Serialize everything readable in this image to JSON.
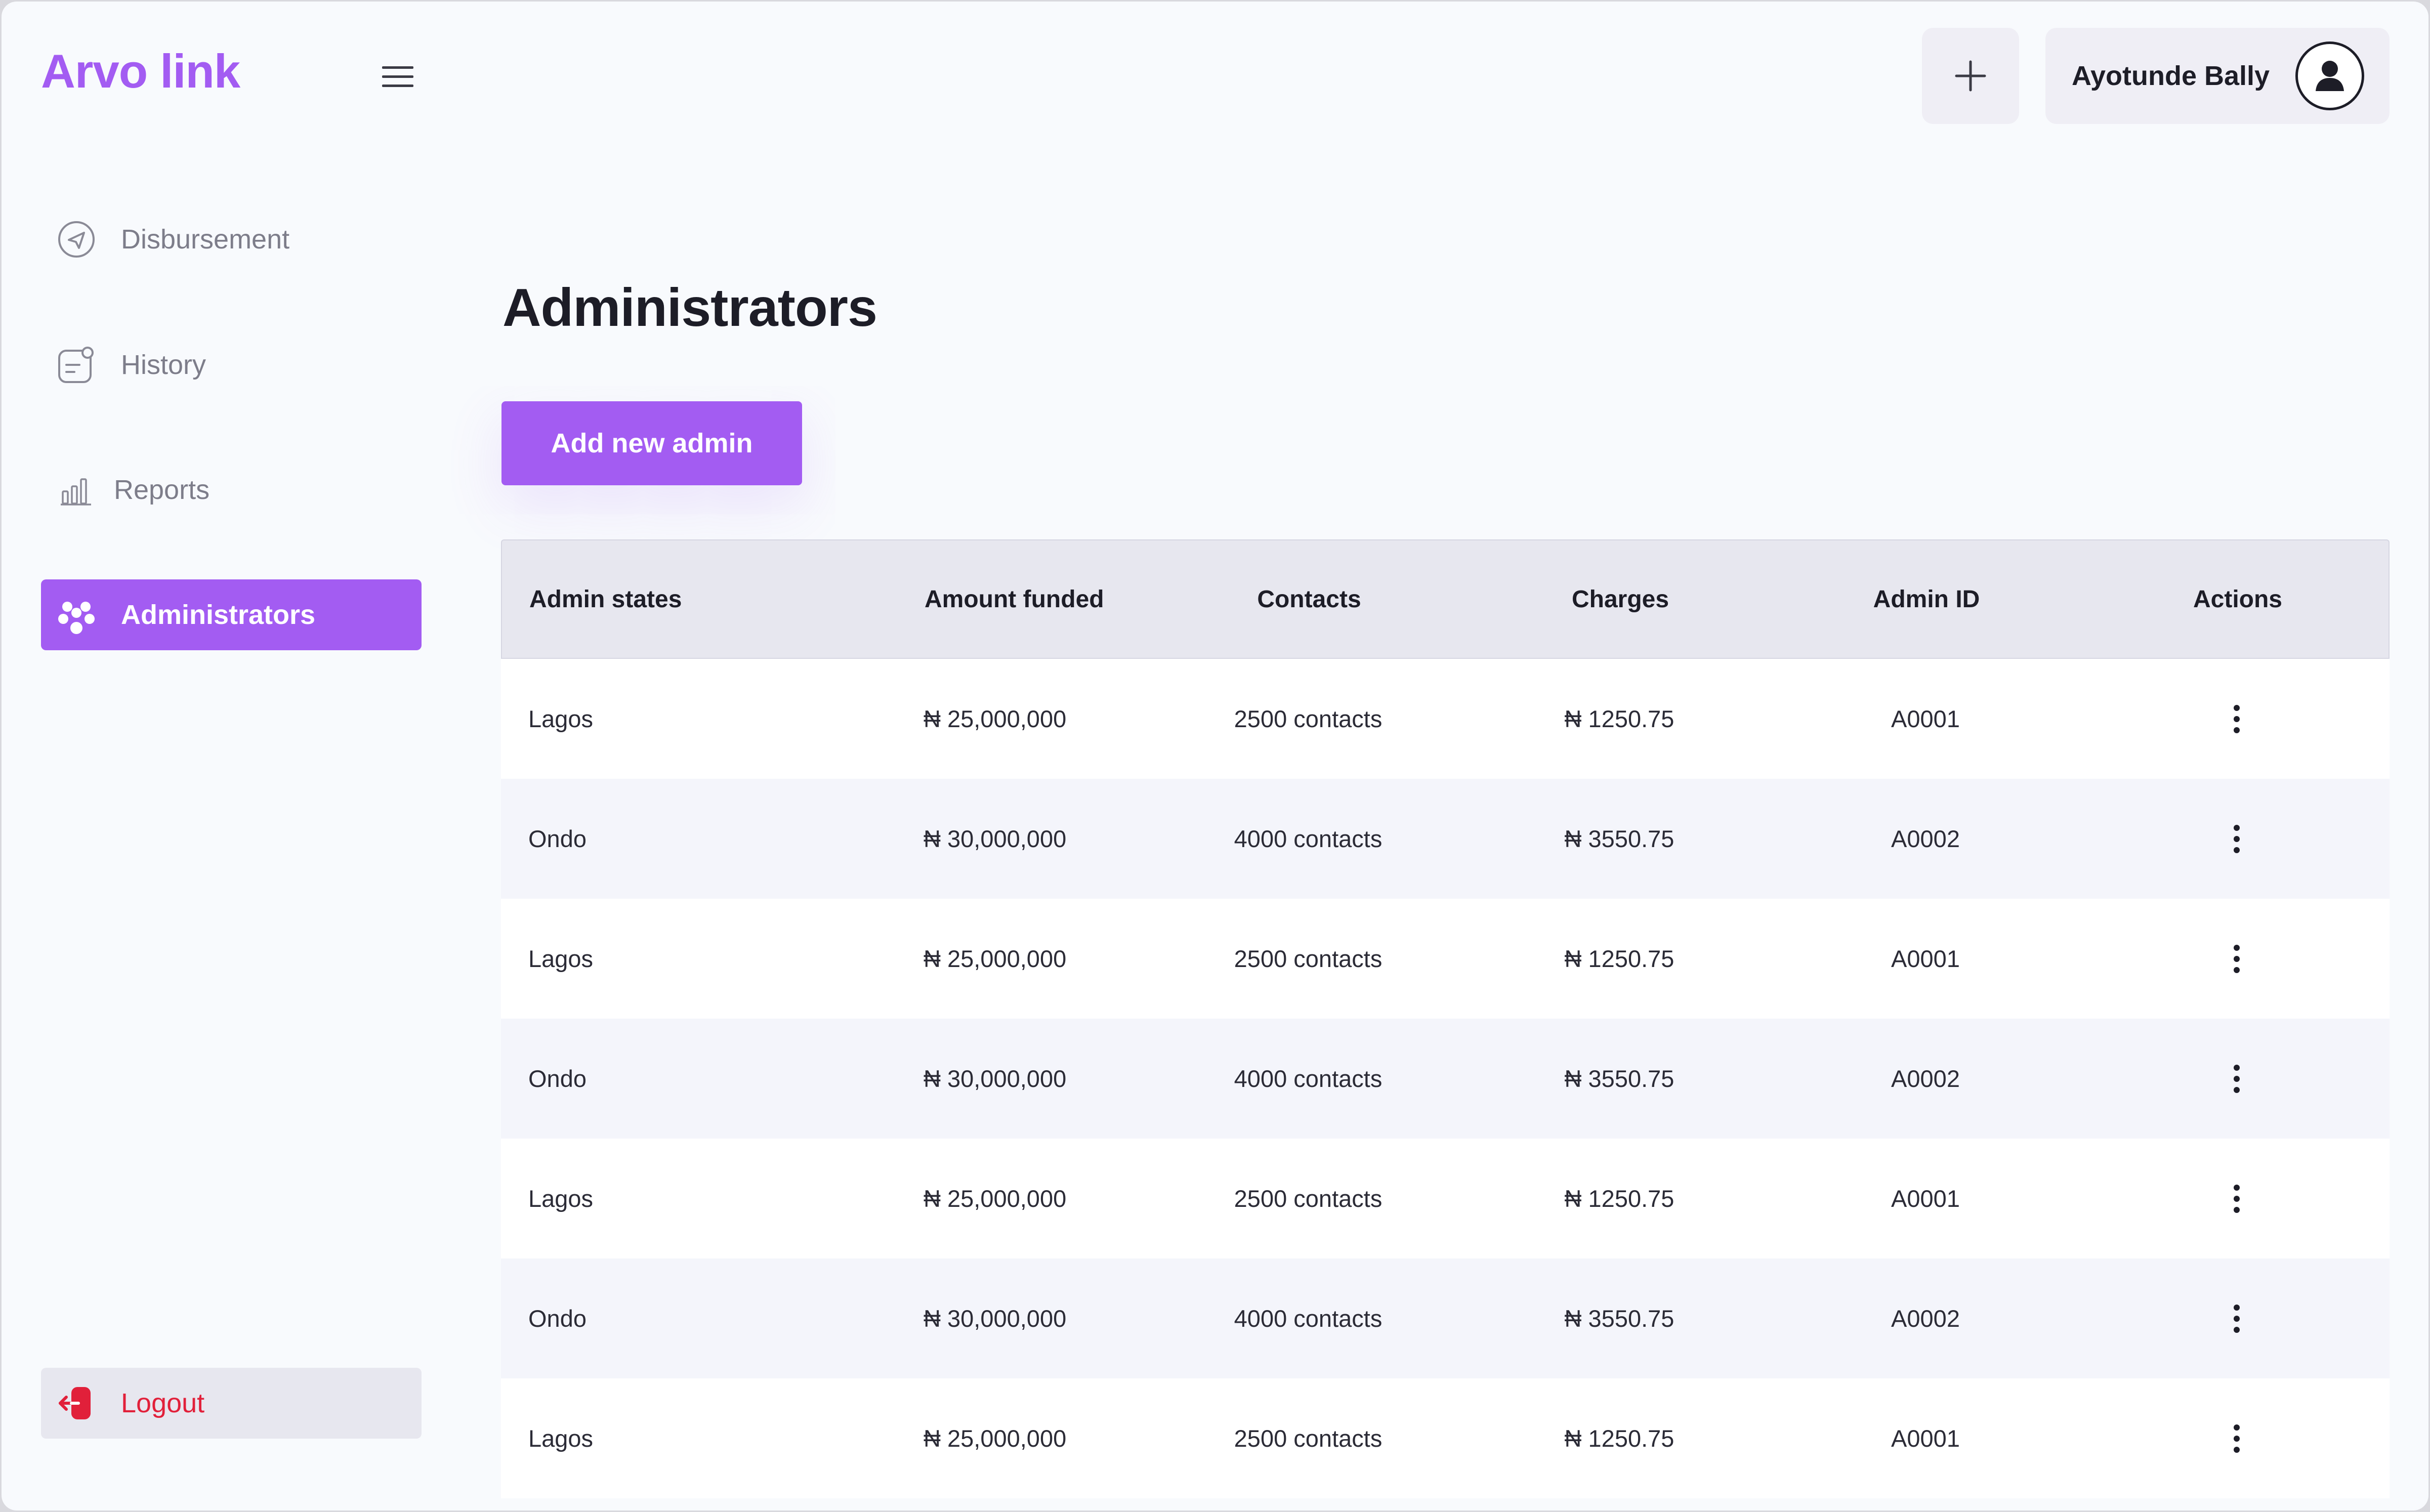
{
  "app": {
    "brand": "Arvo link"
  },
  "sidebar": {
    "items": [
      {
        "label": "Disbursement",
        "icon": "send-icon"
      },
      {
        "label": "History",
        "icon": "history-icon"
      },
      {
        "label": "Reports",
        "icon": "bar-chart-icon"
      },
      {
        "label": "Administrators",
        "icon": "people-icon",
        "active": true
      }
    ],
    "logout": {
      "label": "Logout",
      "icon": "logout-icon"
    }
  },
  "header": {
    "user_name": "Ayotunde Bally"
  },
  "main": {
    "title": "Administrators",
    "add_button": "Add new admin",
    "table": {
      "columns": [
        "Admin states",
        "Amount funded",
        "Contacts",
        "Charges",
        "Admin ID",
        "Actions"
      ],
      "rows": [
        [
          "Lagos",
          "₦ 25,000,000",
          "2500 contacts",
          "₦ 1250.75",
          "A0001"
        ],
        [
          "Ondo",
          "₦ 30,000,000",
          "4000 contacts",
          "₦ 3550.75",
          "A0002"
        ],
        [
          "Lagos",
          "₦ 25,000,000",
          "2500 contacts",
          "₦ 1250.75",
          "A0001"
        ],
        [
          "Ondo",
          "₦ 30,000,000",
          "4000 contacts",
          "₦ 3550.75",
          "A0002"
        ],
        [
          "Lagos",
          "₦ 25,000,000",
          "2500 contacts",
          "₦ 1250.75",
          "A0001"
        ],
        [
          "Ondo",
          "₦ 30,000,000",
          "4000 contacts",
          "₦ 3550.75",
          "A0002"
        ],
        [
          "Lagos",
          "₦ 25,000,000",
          "2500 contacts",
          "₦ 1250.75",
          "A0001"
        ]
      ]
    }
  },
  "colors": {
    "accent": "#a35cf2",
    "danger": "#e1203a",
    "header_bg": "#e7e7ef"
  }
}
